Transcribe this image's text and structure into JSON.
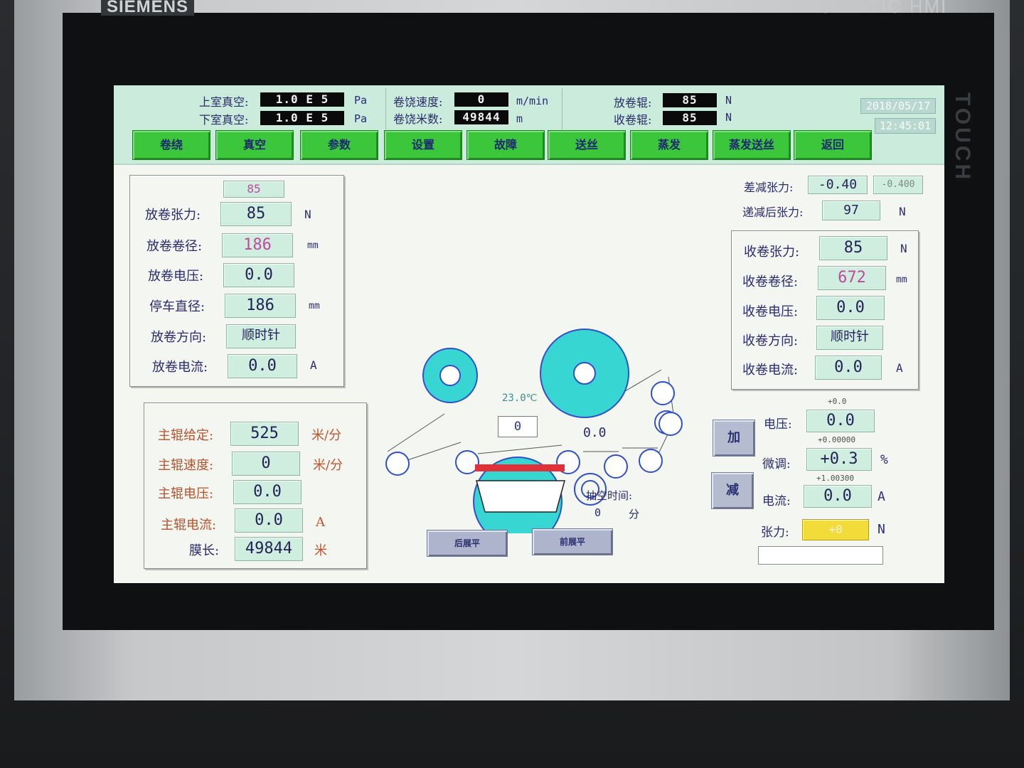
{
  "hardware": {
    "brand_left": "SIEMENS",
    "brand_right": "SIMATIC HMI",
    "touch": "TOUCH"
  },
  "header": {
    "upper_vacuum_label": "上室真空:",
    "upper_vacuum_value": "1.0 E 5",
    "lower_vacuum_label": "下室真空:",
    "lower_vacuum_value": "1.0 E 5",
    "vacuum_unit": "Pa",
    "wind_speed_label": "卷饶速度:",
    "wind_speed_value": "0",
    "wind_speed_unit": "m/min",
    "wind_meter_label": "卷饶米数:",
    "wind_meter_value": "49844",
    "wind_meter_unit": "m",
    "unwind_roll_label": "放卷辊:",
    "unwind_roll_value": "85",
    "rewind_roll_label": "收卷辊:",
    "rewind_roll_value": "85",
    "roll_unit": "N",
    "date": "2018/05/17",
    "time": "12:45:01"
  },
  "nav": [
    "卷绕",
    "真空",
    "参数",
    "设置",
    "故障",
    "送丝",
    "蒸发",
    "蒸发送丝",
    "返回"
  ],
  "unwind": {
    "setpoint": "85",
    "tension_label": "放卷张力:",
    "tension_value": "85",
    "tension_unit": "N",
    "diameter_label": "放卷卷径:",
    "diameter_value": "186",
    "diameter_unit": "mm",
    "voltage_label": "放卷电压:",
    "voltage_value": "0.0",
    "stop_diameter_label": "停车直径:",
    "stop_diameter_value": "186",
    "stop_diameter_unit": "mm",
    "direction_label": "放卷方向:",
    "direction_value": "顺时针",
    "current_label": "放卷电流:",
    "current_value": "0.0",
    "current_unit": "A"
  },
  "main_roll": {
    "set_label": "主辊给定:",
    "set_value": "525",
    "set_unit": "米/分",
    "speed_label": "主辊速度:",
    "speed_value": "0",
    "speed_unit": "米/分",
    "voltage_label": "主辊电压:",
    "voltage_value": "0.0",
    "current_label": "主辊电流:",
    "current_value": "0.0",
    "current_unit": "A",
    "film_label": "膜长:",
    "film_value": "49844",
    "film_unit": "米"
  },
  "taper": {
    "decrement_label": "差减张力:",
    "decrement_value": "-0.40",
    "decrement_ref": "-0.400",
    "after_label": "递减后张力:",
    "after_value": "97",
    "after_unit": "N"
  },
  "rewind": {
    "tension_label": "收卷张力:",
    "tension_value": "85",
    "tension_unit": "N",
    "diameter_label": "收卷卷径:",
    "diameter_value": "672",
    "diameter_unit": "mm",
    "voltage_label": "收卷电压:",
    "voltage_value": "0.0",
    "direction_label": "收卷方向:",
    "direction_value": "顺时针",
    "current_label": "收卷电流:",
    "current_value": "0.0",
    "current_unit": "A"
  },
  "process": {
    "drum_temp": "23.0℃",
    "drum_value": "0",
    "small_roll_value": "0.0",
    "evac_label": "抽空时间:",
    "evac_value": "0",
    "evac_unit": "分",
    "rear_flat_btn": "后展平",
    "front_flat_btn": "前展平"
  },
  "adjust": {
    "plus_btn": "加",
    "minus_btn": "减",
    "voltage_ref": "+0.0",
    "voltage_label": "电压:",
    "voltage_value": "0.0",
    "trim_ref": "+0.00000",
    "trim_label": "微调:",
    "trim_value": "+0.3",
    "trim_unit": "%",
    "current_ref": "+1.00300",
    "current_label": "电流:",
    "current_value": "0.0",
    "current_unit": "A",
    "tension_label": "张力:",
    "tension_value": "+0",
    "tension_unit": "N"
  },
  "colors": {
    "roll_fill": "#37d6d2",
    "roll_stroke": "#3150c8",
    "nav_green": "#3cc63c",
    "heater_red": "#e0303a"
  }
}
